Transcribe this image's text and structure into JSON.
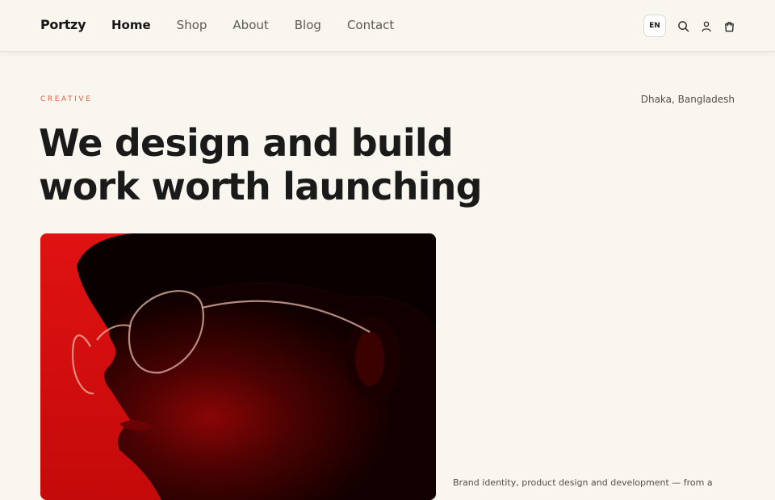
{
  "header": {
    "logo": "Portzy",
    "nav": [
      {
        "label": "Home",
        "active": true
      },
      {
        "label": "Shop",
        "active": false
      },
      {
        "label": "About",
        "active": false
      },
      {
        "label": "Blog",
        "active": false
      },
      {
        "label": "Contact",
        "active": false
      }
    ],
    "language": "EN",
    "icons": [
      "search-icon",
      "user-icon",
      "cart-icon"
    ]
  },
  "hero": {
    "eyebrow": "CREATIVE",
    "location": "Dhaka, Bangladesh",
    "headline_line1": "We design and build",
    "headline_line2": "work worth launching",
    "description": "Brand identity, product design and development — from a"
  },
  "colors": {
    "background": "#f8f6ee",
    "accent": "#e0603a",
    "text": "#1b1b1b",
    "photo_red": "#d40f0f"
  }
}
